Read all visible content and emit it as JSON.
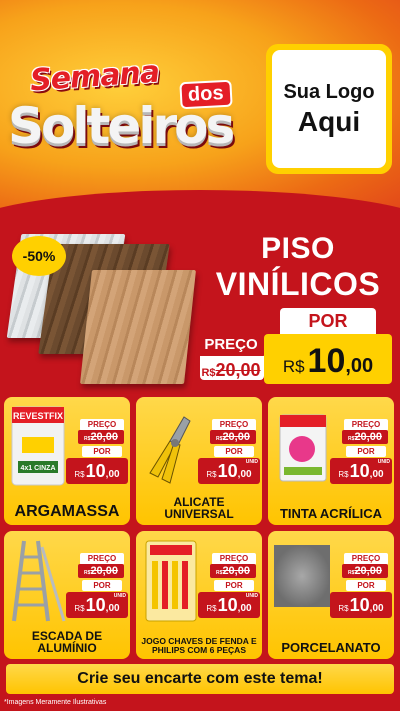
{
  "header": {
    "title_line1": "Semana",
    "title_dos": "dos",
    "title_line2": "Solteiros",
    "logo_line1": "Sua Logo",
    "logo_line2": "Aqui"
  },
  "hero": {
    "discount": "-50%",
    "title1": "PISO",
    "title2": "VINÍLICOS",
    "preco_label": "PREÇO",
    "old_currency": "R$",
    "old_price": "20,00",
    "por_label": "POR",
    "currency": "R$",
    "price_int": "10",
    "price_dec": ",00"
  },
  "products": [
    {
      "name": "ARGAMASSA",
      "preco_label": "PREÇO",
      "old_currency": "R$",
      "old_price": "20,00",
      "por_label": "POR",
      "currency": "R$",
      "price_int": "10",
      "price_dec": ",00",
      "unid": "",
      "brand": "REVESTFIX",
      "sub": "4x1 CINZA"
    },
    {
      "name": "ALICATE UNIVERSAL",
      "preco_label": "PREÇO",
      "old_currency": "R$",
      "old_price": "20,00",
      "por_label": "POR",
      "currency": "R$",
      "price_int": "10",
      "price_dec": ",00",
      "unid": "UNID"
    },
    {
      "name": "TINTA ACRÍLICA",
      "preco_label": "PREÇO",
      "old_currency": "R$",
      "old_price": "20,00",
      "por_label": "POR",
      "currency": "R$",
      "price_int": "10",
      "price_dec": ",00",
      "unid": "UNID"
    },
    {
      "name": "ESCADA DE ALUMÍNIO",
      "preco_label": "PREÇO",
      "old_currency": "R$",
      "old_price": "20,00",
      "por_label": "POR",
      "currency": "R$",
      "price_int": "10",
      "price_dec": ",00",
      "unid": "UNID"
    },
    {
      "name": "JOGO CHAVES DE FENDA E PHILIPS COM 6 PEÇAS",
      "preco_label": "PREÇO",
      "old_currency": "R$",
      "old_price": "20,00",
      "por_label": "POR",
      "currency": "R$",
      "price_int": "10",
      "price_dec": ",00",
      "unid": "UNID"
    },
    {
      "name": "PORCELANATO",
      "preco_label": "PREÇO",
      "old_currency": "R$",
      "old_price": "20,00",
      "por_label": "POR",
      "currency": "R$",
      "price_int": "10",
      "price_dec": ",00",
      "unid": ""
    }
  ],
  "footer": {
    "cta": "Crie seu encarte com este tema!",
    "disclaimer": "*Imagens Meramente Ilustrativas"
  },
  "colors": {
    "red": "#c4141c",
    "yellow": "#ffd000",
    "orange": "#f7a21a"
  }
}
